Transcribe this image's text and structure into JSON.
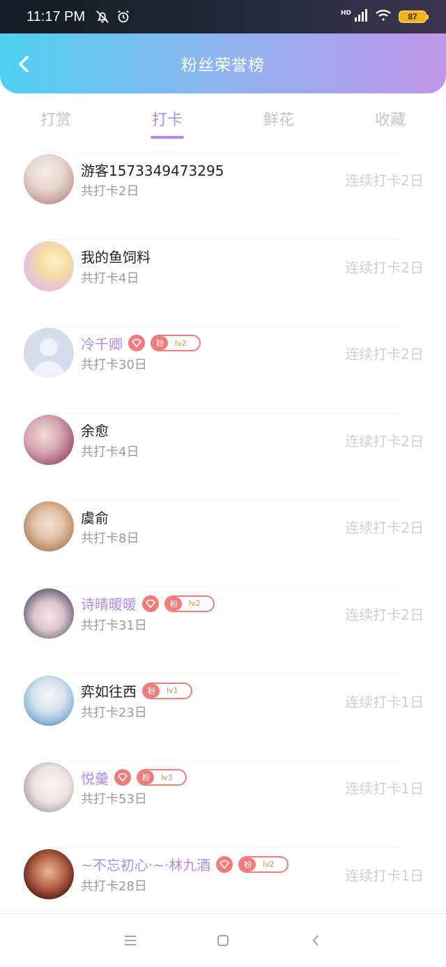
{
  "status": {
    "time": "11:17 PM",
    "network": "HD",
    "battery": "87"
  },
  "header": {
    "title": "粉丝荣誉榜"
  },
  "tabs": [
    {
      "label": "打赏",
      "active": false
    },
    {
      "label": "打卡",
      "active": true
    },
    {
      "label": "鲜花",
      "active": false
    },
    {
      "label": "收藏",
      "active": false
    }
  ],
  "fans": [
    {
      "name": "游客1573349473295",
      "count": "共打卡2日",
      "streak": "连续打卡2日",
      "vip": false,
      "badge": null
    },
    {
      "name": "我的鱼饲料",
      "count": "共打卡4日",
      "streak": "连续打卡2日",
      "vip": false,
      "badge": null
    },
    {
      "name": "冷千卿",
      "count": "共打卡30日",
      "streak": "连续打卡2日",
      "vip": true,
      "badge": {
        "fan": "粉",
        "level": "lv2"
      }
    },
    {
      "name": "余愈",
      "count": "共打卡4日",
      "streak": "连续打卡2日",
      "vip": false,
      "badge": null
    },
    {
      "name": "虞俞",
      "count": "共打卡8日",
      "streak": "连续打卡2日",
      "vip": false,
      "badge": null
    },
    {
      "name": "诗晴暖暖",
      "count": "共打卡31日",
      "streak": "连续打卡2日",
      "vip": true,
      "badge": {
        "fan": "粉",
        "level": "lv2"
      }
    },
    {
      "name": "弈如往西",
      "count": "共打卡23日",
      "streak": "连续打卡1日",
      "vip": false,
      "badge": {
        "fan": "粉",
        "level": "lv1"
      }
    },
    {
      "name": "悦羹",
      "count": "共打卡53日",
      "streak": "连续打卡1日",
      "vip": true,
      "badge": {
        "fan": "粉",
        "level": "lv3"
      }
    },
    {
      "name": "~不忘初心·~·林九酒",
      "count": "共打卡28日",
      "streak": "连续打卡1日",
      "vip": true,
      "badge": {
        "fan": "粉",
        "level": "lv2"
      }
    }
  ],
  "colors": {
    "accent": "#b58ae6",
    "badge": "#f07b7b",
    "header_start": "#4fd1f5",
    "header_end": "#c197ea"
  }
}
